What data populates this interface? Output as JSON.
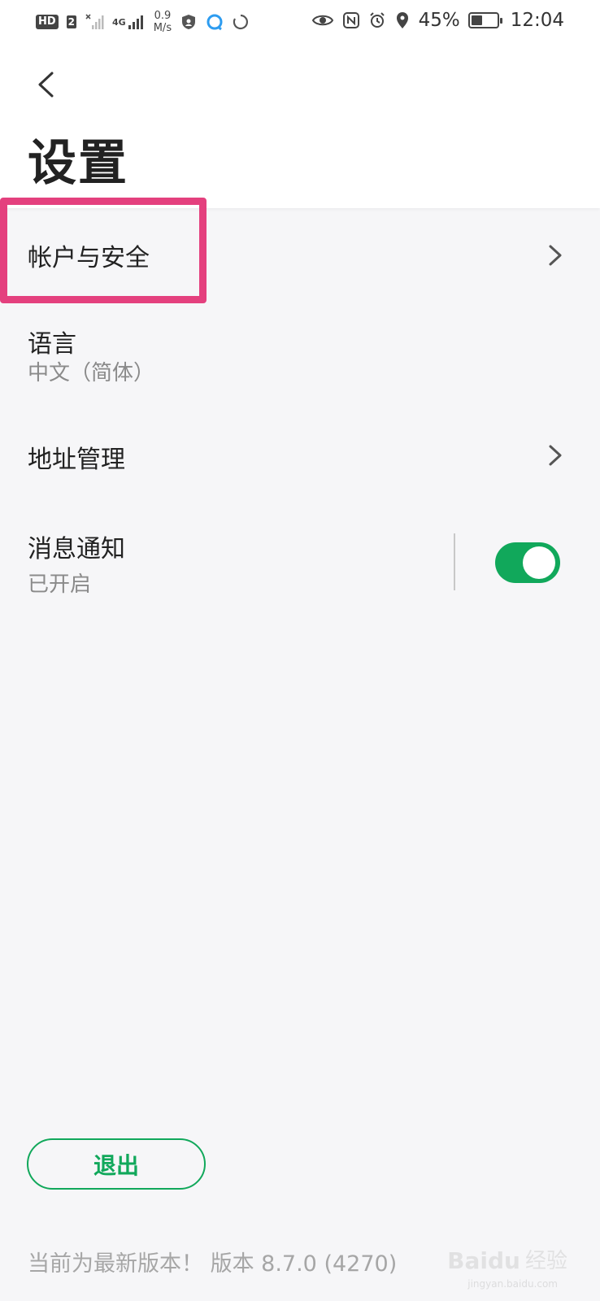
{
  "status_bar": {
    "hd_label": "HD",
    "sim_label": "2",
    "network_label": "4G",
    "speed_value": "0.9",
    "speed_unit": "M/s",
    "battery_text": "45%",
    "battery_level": 45,
    "time": "12:04"
  },
  "header": {
    "title": "设置"
  },
  "settings": {
    "items": [
      {
        "title": "帐户与安全"
      },
      {
        "title": "语言",
        "subtitle": "中文（简体）"
      },
      {
        "title": "地址管理"
      },
      {
        "title": "消息通知",
        "subtitle": "已开启",
        "toggle_on": true
      }
    ]
  },
  "footer": {
    "logout_label": "退出",
    "version_text": "当前为最新版本！ 版本 8.7.0 (4270)"
  },
  "watermark": {
    "logo": "Baidu",
    "text": "经验",
    "url": "jingyan.baidu.com"
  },
  "colors": {
    "accent": "#11a85b",
    "highlight": "#e4407e",
    "background": "#f6f6f8"
  }
}
